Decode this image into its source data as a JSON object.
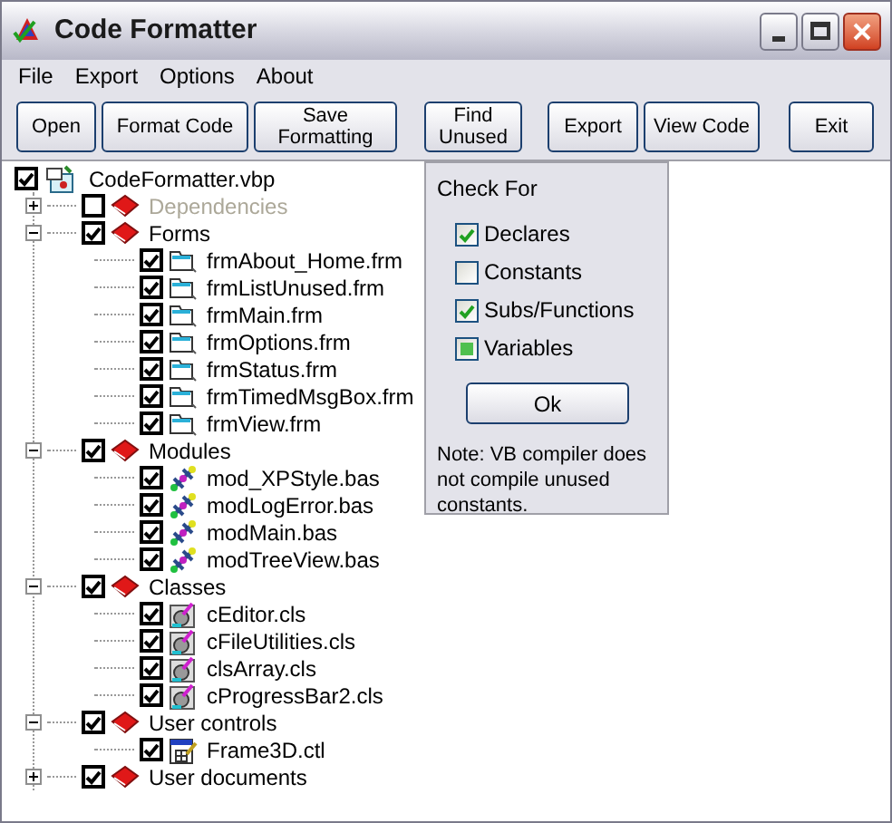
{
  "window": {
    "title": "Code Formatter"
  },
  "menu": [
    "File",
    "Export",
    "Options",
    "About"
  ],
  "toolbar": [
    "Open",
    "Format Code",
    "Save Formatting",
    "Find Unused",
    "Export",
    "View Code",
    "Exit"
  ],
  "tree": {
    "label": "CodeFormatter.vbp",
    "kind": "project",
    "checked": true,
    "children": [
      {
        "label": "Dependencies",
        "kind": "group",
        "checked": false,
        "expanded": false,
        "disabled": true
      },
      {
        "label": "Forms",
        "kind": "group",
        "checked": true,
        "expanded": true,
        "disabled": false,
        "children": [
          {
            "label": "frmAbout_Home.frm",
            "kind": "form",
            "checked": true
          },
          {
            "label": "frmListUnused.frm",
            "kind": "form",
            "checked": true
          },
          {
            "label": "frmMain.frm",
            "kind": "form",
            "checked": true
          },
          {
            "label": "frmOptions.frm",
            "kind": "form",
            "checked": true
          },
          {
            "label": "frmStatus.frm",
            "kind": "form",
            "checked": true
          },
          {
            "label": "frmTimedMsgBox.frm",
            "kind": "form",
            "checked": true
          },
          {
            "label": "frmView.frm",
            "kind": "form",
            "checked": true
          }
        ]
      },
      {
        "label": "Modules",
        "kind": "group",
        "checked": true,
        "expanded": true,
        "disabled": false,
        "children": [
          {
            "label": "mod_XPStyle.bas",
            "kind": "module",
            "checked": true
          },
          {
            "label": "modLogError.bas",
            "kind": "module",
            "checked": true
          },
          {
            "label": "modMain.bas",
            "kind": "module",
            "checked": true
          },
          {
            "label": "modTreeView.bas",
            "kind": "module",
            "checked": true
          }
        ]
      },
      {
        "label": "Classes",
        "kind": "group",
        "checked": true,
        "expanded": true,
        "disabled": false,
        "children": [
          {
            "label": "cEditor.cls",
            "kind": "class",
            "checked": true
          },
          {
            "label": "cFileUtilities.cls",
            "kind": "class",
            "checked": true
          },
          {
            "label": "clsArray.cls",
            "kind": "class",
            "checked": true
          },
          {
            "label": "cProgressBar2.cls",
            "kind": "class",
            "checked": true
          }
        ]
      },
      {
        "label": "User controls",
        "kind": "group",
        "checked": true,
        "expanded": true,
        "disabled": false,
        "children": [
          {
            "label": "Frame3D.ctl",
            "kind": "control",
            "checked": true
          }
        ]
      },
      {
        "label": "User documents",
        "kind": "group",
        "checked": true,
        "expanded": false,
        "disabled": false
      }
    ]
  },
  "check_for": {
    "title": "Check For",
    "options": [
      {
        "label": "Declares",
        "checked": true,
        "mixed": false
      },
      {
        "label": "Constants",
        "checked": false,
        "mixed": false
      },
      {
        "label": "Subs/Functions",
        "checked": true,
        "mixed": false
      },
      {
        "label": "Variables",
        "checked": false,
        "mixed": true
      }
    ],
    "button": "Ok",
    "note": "Note: VB compiler does not compile unused constants."
  }
}
